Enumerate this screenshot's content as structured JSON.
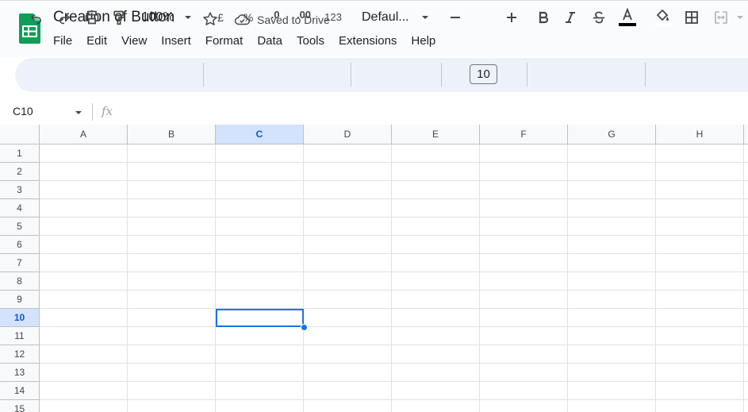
{
  "app": {
    "title": "Creation of Button",
    "save_status": "Saved to Drive"
  },
  "menu": [
    "File",
    "Edit",
    "View",
    "Insert",
    "Format",
    "Data",
    "Tools",
    "Extensions",
    "Help"
  ],
  "toolbar": {
    "zoom": "100%",
    "currency": "£",
    "percent": "%",
    "decrease_decimal": ".0",
    "increase_decimal": ".00",
    "more_formats": "123",
    "font": "Defaul...",
    "font_size": "10",
    "icons": [
      "undo-icon",
      "redo-icon",
      "print-icon",
      "paint-format-icon",
      "bold-icon",
      "italic-icon",
      "strikethrough-icon",
      "text-color-icon",
      "fill-color-icon",
      "borders-icon",
      "merge-cells-icon"
    ],
    "text_color": "#000000"
  },
  "formula_bar": {
    "name_box": "C10",
    "fx": "fx",
    "value": ""
  },
  "sheet": {
    "columns": [
      "A",
      "B",
      "C",
      "D",
      "E",
      "F",
      "G",
      "H"
    ],
    "rows": [
      "1",
      "2",
      "3",
      "4",
      "5",
      "6",
      "7",
      "8",
      "9",
      "10",
      "11",
      "12",
      "13",
      "14",
      "15"
    ],
    "selected_column": "C",
    "selected_row": "10",
    "active_cell": "C10"
  },
  "colors": {
    "accent": "#1a73e8",
    "logo": "#0f9d58",
    "selected_header": "#d3e3fd"
  }
}
